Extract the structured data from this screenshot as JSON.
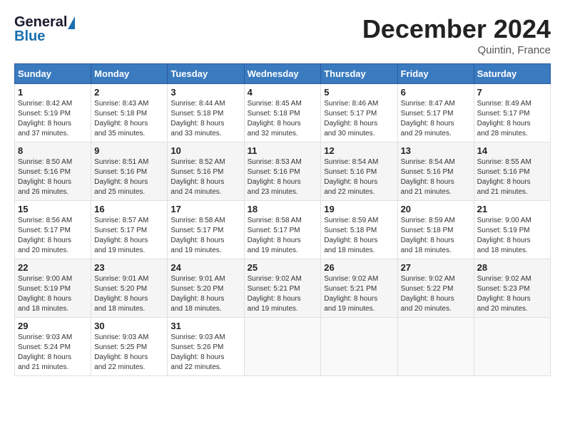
{
  "header": {
    "logo_general": "General",
    "logo_blue": "Blue",
    "month_title": "December 2024",
    "location": "Quintin, France"
  },
  "columns": [
    "Sunday",
    "Monday",
    "Tuesday",
    "Wednesday",
    "Thursday",
    "Friday",
    "Saturday"
  ],
  "weeks": [
    [
      {
        "day": "1",
        "info": "Sunrise: 8:42 AM\nSunset: 5:19 PM\nDaylight: 8 hours\nand 37 minutes."
      },
      {
        "day": "2",
        "info": "Sunrise: 8:43 AM\nSunset: 5:18 PM\nDaylight: 8 hours\nand 35 minutes."
      },
      {
        "day": "3",
        "info": "Sunrise: 8:44 AM\nSunset: 5:18 PM\nDaylight: 8 hours\nand 33 minutes."
      },
      {
        "day": "4",
        "info": "Sunrise: 8:45 AM\nSunset: 5:18 PM\nDaylight: 8 hours\nand 32 minutes."
      },
      {
        "day": "5",
        "info": "Sunrise: 8:46 AM\nSunset: 5:17 PM\nDaylight: 8 hours\nand 30 minutes."
      },
      {
        "day": "6",
        "info": "Sunrise: 8:47 AM\nSunset: 5:17 PM\nDaylight: 8 hours\nand 29 minutes."
      },
      {
        "day": "7",
        "info": "Sunrise: 8:49 AM\nSunset: 5:17 PM\nDaylight: 8 hours\nand 28 minutes."
      }
    ],
    [
      {
        "day": "8",
        "info": "Sunrise: 8:50 AM\nSunset: 5:16 PM\nDaylight: 8 hours\nand 26 minutes."
      },
      {
        "day": "9",
        "info": "Sunrise: 8:51 AM\nSunset: 5:16 PM\nDaylight: 8 hours\nand 25 minutes."
      },
      {
        "day": "10",
        "info": "Sunrise: 8:52 AM\nSunset: 5:16 PM\nDaylight: 8 hours\nand 24 minutes."
      },
      {
        "day": "11",
        "info": "Sunrise: 8:53 AM\nSunset: 5:16 PM\nDaylight: 8 hours\nand 23 minutes."
      },
      {
        "day": "12",
        "info": "Sunrise: 8:54 AM\nSunset: 5:16 PM\nDaylight: 8 hours\nand 22 minutes."
      },
      {
        "day": "13",
        "info": "Sunrise: 8:54 AM\nSunset: 5:16 PM\nDaylight: 8 hours\nand 21 minutes."
      },
      {
        "day": "14",
        "info": "Sunrise: 8:55 AM\nSunset: 5:16 PM\nDaylight: 8 hours\nand 21 minutes."
      }
    ],
    [
      {
        "day": "15",
        "info": "Sunrise: 8:56 AM\nSunset: 5:17 PM\nDaylight: 8 hours\nand 20 minutes."
      },
      {
        "day": "16",
        "info": "Sunrise: 8:57 AM\nSunset: 5:17 PM\nDaylight: 8 hours\nand 19 minutes."
      },
      {
        "day": "17",
        "info": "Sunrise: 8:58 AM\nSunset: 5:17 PM\nDaylight: 8 hours\nand 19 minutes."
      },
      {
        "day": "18",
        "info": "Sunrise: 8:58 AM\nSunset: 5:17 PM\nDaylight: 8 hours\nand 19 minutes."
      },
      {
        "day": "19",
        "info": "Sunrise: 8:59 AM\nSunset: 5:18 PM\nDaylight: 8 hours\nand 18 minutes."
      },
      {
        "day": "20",
        "info": "Sunrise: 8:59 AM\nSunset: 5:18 PM\nDaylight: 8 hours\nand 18 minutes."
      },
      {
        "day": "21",
        "info": "Sunrise: 9:00 AM\nSunset: 5:19 PM\nDaylight: 8 hours\nand 18 minutes."
      }
    ],
    [
      {
        "day": "22",
        "info": "Sunrise: 9:00 AM\nSunset: 5:19 PM\nDaylight: 8 hours\nand 18 minutes."
      },
      {
        "day": "23",
        "info": "Sunrise: 9:01 AM\nSunset: 5:20 PM\nDaylight: 8 hours\nand 18 minutes."
      },
      {
        "day": "24",
        "info": "Sunrise: 9:01 AM\nSunset: 5:20 PM\nDaylight: 8 hours\nand 18 minutes."
      },
      {
        "day": "25",
        "info": "Sunrise: 9:02 AM\nSunset: 5:21 PM\nDaylight: 8 hours\nand 19 minutes."
      },
      {
        "day": "26",
        "info": "Sunrise: 9:02 AM\nSunset: 5:21 PM\nDaylight: 8 hours\nand 19 minutes."
      },
      {
        "day": "27",
        "info": "Sunrise: 9:02 AM\nSunset: 5:22 PM\nDaylight: 8 hours\nand 20 minutes."
      },
      {
        "day": "28",
        "info": "Sunrise: 9:02 AM\nSunset: 5:23 PM\nDaylight: 8 hours\nand 20 minutes."
      }
    ],
    [
      {
        "day": "29",
        "info": "Sunrise: 9:03 AM\nSunset: 5:24 PM\nDaylight: 8 hours\nand 21 minutes."
      },
      {
        "day": "30",
        "info": "Sunrise: 9:03 AM\nSunset: 5:25 PM\nDaylight: 8 hours\nand 22 minutes."
      },
      {
        "day": "31",
        "info": "Sunrise: 9:03 AM\nSunset: 5:26 PM\nDaylight: 8 hours\nand 22 minutes."
      },
      null,
      null,
      null,
      null
    ]
  ]
}
